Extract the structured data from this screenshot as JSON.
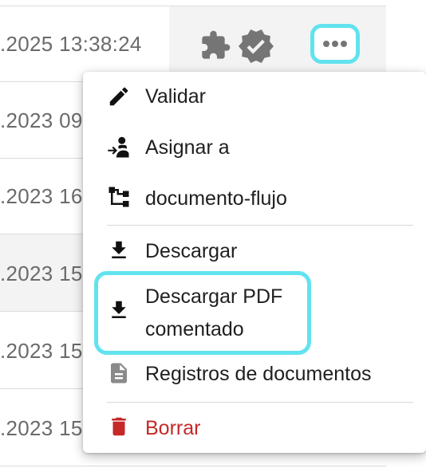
{
  "rows": [
    {
      "date": ".2025 13:38:24"
    },
    {
      "date": ".2023 09"
    },
    {
      "date": ".2023 16"
    },
    {
      "date": ".2023 15"
    },
    {
      "date": ".2023 15"
    },
    {
      "date": ".2023 15"
    }
  ],
  "icons": {
    "plugin": "puzzle-icon",
    "verified": "verified-badge-icon",
    "more": "more-horizontal-icon"
  },
  "menu": {
    "items": [
      {
        "label": "Validar",
        "icon": "pencil-icon"
      },
      {
        "label": "Asignar a",
        "icon": "assign-user-icon"
      },
      {
        "label": "documento-flujo",
        "icon": "workflow-icon"
      },
      {
        "label": "Descargar",
        "icon": "download-icon"
      },
      {
        "label": "Descargar PDF",
        "label2": "comentado",
        "icon": "download-icon"
      },
      {
        "label": "Registros de documentos",
        "icon": "document-icon"
      },
      {
        "label": "Borrar",
        "icon": "trash-icon"
      }
    ]
  },
  "colors": {
    "highlight": "#61e3ef",
    "danger": "#c62828",
    "icon_grey": "#757575"
  }
}
